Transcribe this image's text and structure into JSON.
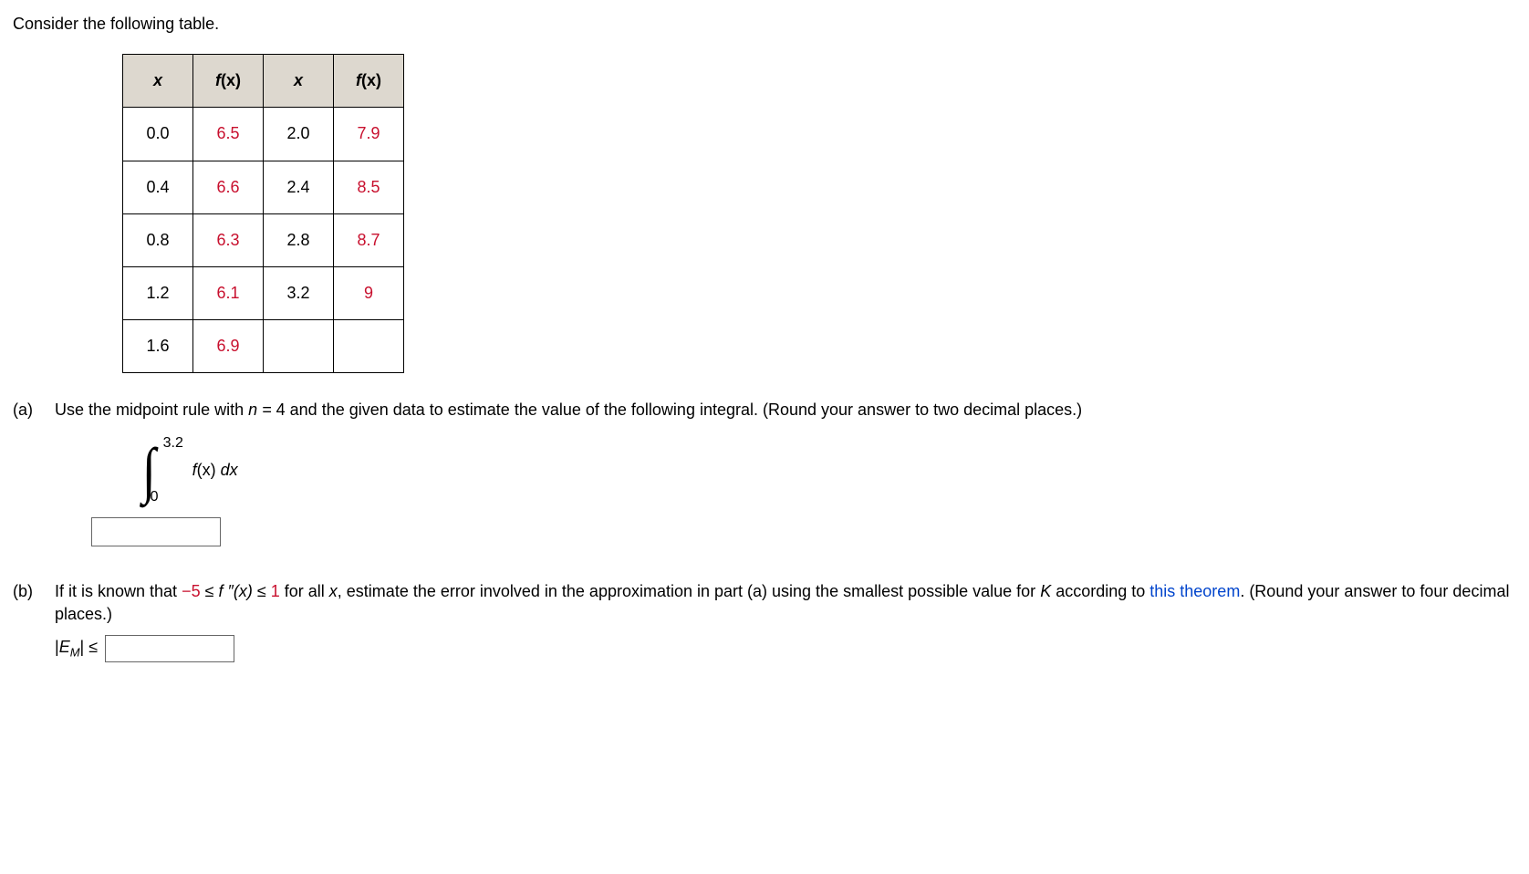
{
  "intro": "Consider the following table.",
  "headers": {
    "x": "x",
    "fx_open": "f",
    "fx_paren": "(x)"
  },
  "rows": [
    {
      "x1": "0.0",
      "f1": "6.5",
      "x2": "2.0",
      "f2": "7.9"
    },
    {
      "x1": "0.4",
      "f1": "6.6",
      "x2": "2.4",
      "f2": "8.5"
    },
    {
      "x1": "0.8",
      "f1": "6.3",
      "x2": "2.8",
      "f2": "8.7"
    },
    {
      "x1": "1.2",
      "f1": "6.1",
      "x2": "3.2",
      "f2": "9"
    },
    {
      "x1": "1.6",
      "f1": "6.9",
      "x2": "",
      "f2": ""
    }
  ],
  "part_a": {
    "label": "(a)",
    "text_before": "Use the midpoint rule with ",
    "n_eq": "n = ",
    "n_val": "4",
    "text_after": " and the given data to estimate the value of the following integral. (Round your answer to two decimal places.)",
    "upper": "3.2",
    "lower": "0",
    "integrand_f": "f",
    "integrand_x": "(x) ",
    "integrand_dx": "dx"
  },
  "part_b": {
    "label": "(b)",
    "text1": "If it is known that ",
    "neg5": "−5",
    "leq1": " ≤ ",
    "fpp": "f ″(x)",
    "leq2": " ≤ ",
    "one": "1",
    "text2": " for all ",
    "xvar": "x",
    "text3": ", estimate the error involved in the approximation in part (a) using the smallest possible value for ",
    "Kvar": "K",
    "text4": " according to ",
    "link": "this theorem",
    "text5": ". (Round your answer to four decimal places.)",
    "em_open": "|",
    "em_E": "E",
    "em_M": "M",
    "em_close": "|",
    "em_leq": " ≤ "
  }
}
